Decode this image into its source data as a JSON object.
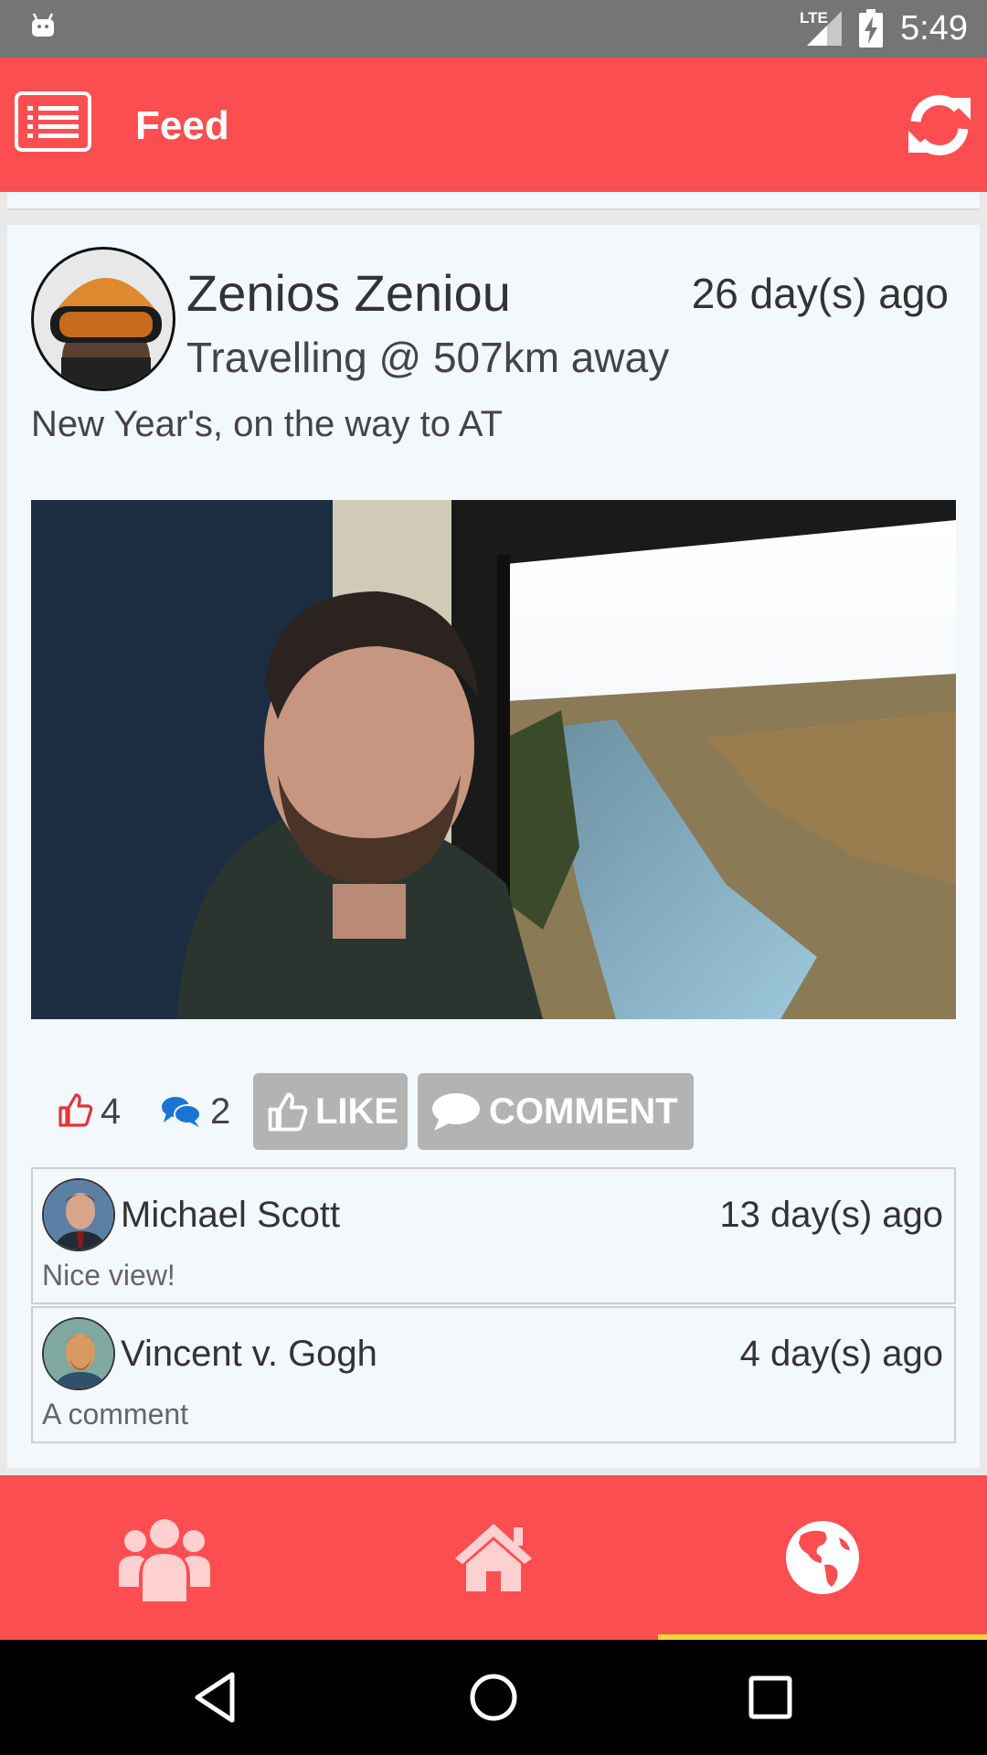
{
  "status_bar": {
    "network": "LTE",
    "time": "5:49"
  },
  "app_bar": {
    "title": "Feed",
    "menu_icon": "list-menu-icon",
    "refresh_icon": "refresh-icon"
  },
  "post": {
    "author": "Zenios Zeniou",
    "time": "26 day(s) ago",
    "location": "Travelling @ 507km away",
    "caption": "New Year's, on the way to AT",
    "likes": "4",
    "comments_count": "2",
    "like_button": "LIKE",
    "comment_button": "COMMENT"
  },
  "comments": [
    {
      "author": "Michael Scott",
      "time": "13 day(s) ago",
      "text": "Nice view!"
    },
    {
      "author": "Vincent v. Gogh",
      "time": "4 day(s) ago",
      "text": "A comment"
    }
  ],
  "bottom_nav": {
    "items": [
      {
        "icon": "users-icon",
        "selected": false
      },
      {
        "icon": "home-icon",
        "selected": false
      },
      {
        "icon": "globe-icon",
        "selected": true
      }
    ],
    "indicator_color": "#f3d33a"
  },
  "colors": {
    "accent": "#fc4e50",
    "status_bar": "#757575",
    "button_gray": "#b3b3b3",
    "like_red": "#e8323a",
    "comment_blue": "#1a74d6"
  }
}
